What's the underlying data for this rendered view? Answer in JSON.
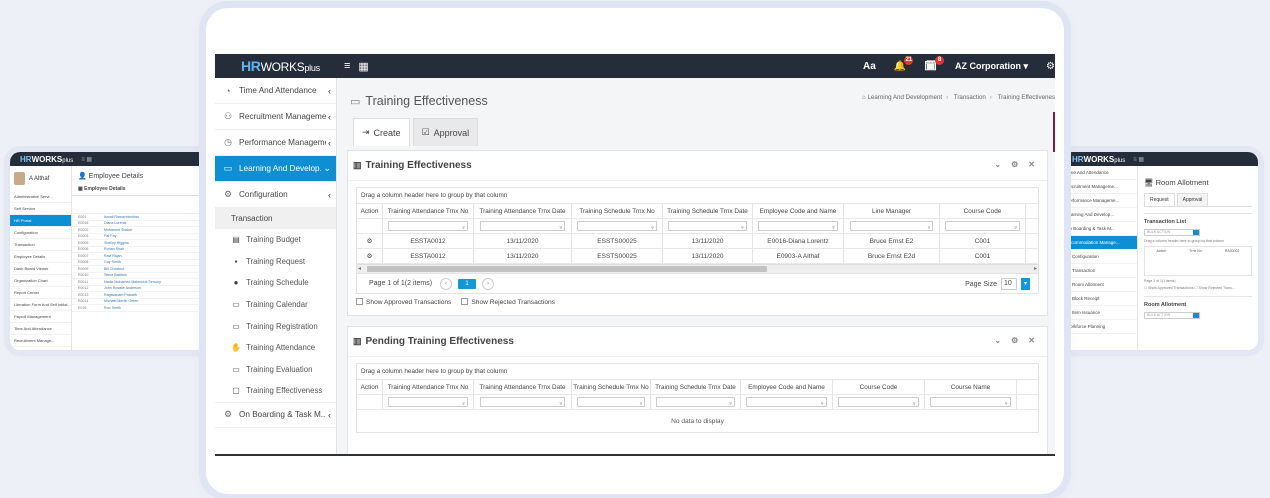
{
  "app": {
    "logo_hr": "HR",
    "logo_works": "WORKS",
    "logo_plus": "plus",
    "notif_count": "21",
    "task_count": "8",
    "company": "AZ Corporation",
    "font_label": "Aa"
  },
  "sidebar": {
    "items": [
      {
        "label": "Time And Attendance",
        "icon": "clock-icon",
        "chevron": "‹"
      },
      {
        "label": "Recruitment Manageme...",
        "icon": "recruitment-icon",
        "chevron": "‹"
      },
      {
        "label": "Performance Manageme...",
        "icon": "performance-icon",
        "chevron": "‹"
      },
      {
        "label": "Learning And Develop...",
        "icon": "monitor-icon",
        "chevron": "⌄"
      },
      {
        "label": "Configuration",
        "icon": "settings-icon",
        "chevron": "‹"
      }
    ],
    "transaction_label": "Transaction",
    "sub_items": [
      {
        "label": "Training Budget",
        "icon": "budget-icon"
      },
      {
        "label": "Training Request",
        "icon": "request-icon"
      },
      {
        "label": "Training Schedule",
        "icon": "schedule-icon"
      },
      {
        "label": "Training Calendar",
        "icon": "calendar-icon"
      },
      {
        "label": "Training Registration",
        "icon": "registration-icon"
      },
      {
        "label": "Training Attendance",
        "icon": "attendance-icon"
      },
      {
        "label": "Training Evaluation",
        "icon": "evaluation-icon"
      },
      {
        "label": "Training Effectiveness",
        "icon": "effectiveness-icon"
      }
    ],
    "last_item": {
      "label": "On Boarding & Task M...",
      "icon": "onboarding-icon",
      "chevron": "‹"
    }
  },
  "page": {
    "title": "Training Effectiveness",
    "breadcrumb": [
      "Learning And Development",
      "Transaction",
      "Training Effectivenes"
    ],
    "tabs": [
      {
        "label": "Create",
        "icon": "create-icon"
      },
      {
        "label": "Approval",
        "icon": "approval-icon"
      }
    ]
  },
  "effectiveness_card": {
    "title": "Training Effectiveness",
    "group_hint": "Drag a column header here to group by that column",
    "columns": [
      "Action",
      "Training Attendance Trnx No",
      "Training Attendance Trnx Date",
      "Training Schedule Trnx No",
      "Training Schedule Trnx Date",
      "Employee Code and Name",
      "Line Manager",
      "Course Code"
    ],
    "rows": [
      [
        "ESSTA0012",
        "13/11/2020",
        "ESSTS00025",
        "13/11/2020",
        "E0016-Diana Lorentz",
        "Bruce Ernst E2",
        "C001"
      ],
      [
        "ESSTA0012",
        "13/11/2020",
        "ESSTS00025",
        "13/11/2020",
        "E0903-A Althaf",
        "Bruce Ernst E2d",
        "C001"
      ]
    ],
    "page_info": "Page 1 of 1(2 items)",
    "current_page": "1",
    "page_size_label": "Page Size",
    "page_size": "10",
    "show_approved": "Show Approved Transactions",
    "show_rejected": "Show Rejected Transactions"
  },
  "pending_card": {
    "title": "Pending Training Effectiveness",
    "group_hint": "Drag a column header here to group by that column",
    "columns": [
      "Action",
      "Training Attendance Trnx No",
      "Training Attendance Trnx Date",
      "Training Schedule Trnx No",
      "Training Schedule Trnx Date",
      "Employee Code and Name",
      "Course Code",
      "Course Name"
    ],
    "no_data": "No data to display"
  },
  "left_thumb": {
    "user": "A Althaf",
    "title": "Employee Details",
    "sub": "Employee Details",
    "nav": [
      "Administrative Servi...",
      "Self Service",
      "HR Portal",
      "Configuration",
      "Transaction",
      "Employee Details",
      "Dash Board Viewer",
      "Organization Chart",
      "Report Center",
      "Literation Form And Self Initial...",
      "Payroll Management",
      "Time And Attendance",
      "Recruitment Manage..."
    ],
    "rows": [
      [
        "E001",
        "Ismail Ramachandran"
      ],
      [
        "E0016",
        "Diana Lorentz"
      ],
      [
        "E0002",
        "Mohamed Shaker"
      ],
      [
        "E0003",
        "Pat Fay"
      ],
      [
        "E0005",
        "Shelley Higgins"
      ],
      [
        "E0006",
        "Rohan Shah"
      ],
      [
        "E0007",
        "Ravi Rajan"
      ],
      [
        "E0008",
        "Guy Smith"
      ],
      [
        "E0009",
        "Bill Chestnut"
      ],
      [
        "E0010",
        "Steve Baldwin"
      ],
      [
        "E0011",
        "Nadia Mohamed Mahmoud Seroury"
      ],
      [
        "E0012",
        "John Rosalie Anderson"
      ],
      [
        "E0013",
        "Ragavanam Prasath"
      ],
      [
        "E0014",
        "Michael Mertin Green"
      ],
      [
        "E015",
        "Ron Smith"
      ]
    ]
  },
  "right_thumb": {
    "title": "Room Allotment",
    "tabs": [
      "Request",
      "Approval"
    ],
    "nav": [
      "Time And Attendance",
      "Recruitment Manageme...",
      "Performance Manageme...",
      "Learning And Develop...",
      "On Boarding & Task M...",
      "Accommodation Manage...",
      "Configuration",
      "Transaction",
      "Room Allotment",
      "Block Receipt",
      "Item Issuance",
      "Workforce Planning"
    ],
    "list_title": "Transaction List",
    "bulk_action": "BULK ACTION",
    "group_hint": "Drag a column header here to group by that column",
    "cols": [
      "Action",
      "Trnx No"
    ],
    "row_value": "RA00002",
    "page_info": "Page 1 of 1(1 items)",
    "show_approved": "Show Approved Transactions",
    "show_rejected": "Show Rejected Trans...",
    "form_title": "Room Allotment",
    "form_action": "BULK ACTION"
  }
}
